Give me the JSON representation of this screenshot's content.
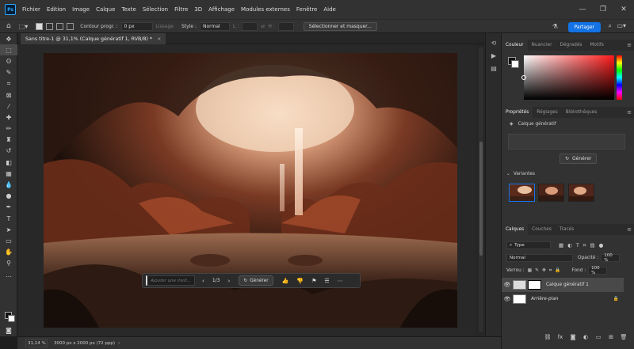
{
  "app": {
    "logo": "Ps"
  },
  "menu": [
    "Fichier",
    "Edition",
    "Image",
    "Calque",
    "Texte",
    "Sélection",
    "Filtre",
    "3D",
    "Affichage",
    "Modules externes",
    "Fenêtre",
    "Aide"
  ],
  "window_controls": {
    "minimize": "—",
    "restore": "❐",
    "close": "✕"
  },
  "options_bar": {
    "feather_label": "Contour progr. :",
    "feather_value": "0 px",
    "antialias_label": "Lissage",
    "style_label": "Style :",
    "style_value": "Normal",
    "width_label": "L :",
    "height_label": "H :",
    "select_mask_label": "Sélectionner et masquer...",
    "share_label": "Partager"
  },
  "document": {
    "tab_title": "Sans titre-1 @ 31,1% (Calque génératif 1, RVB/8) *",
    "close": "×"
  },
  "contextual_bar": {
    "placeholder": "Ajouter une invit...",
    "variation_counter": "1/3",
    "prev": "‹",
    "next": "›",
    "generate_label": "Générer"
  },
  "status_bar": {
    "zoom": "31,14 %",
    "doc_size": "3000 px x 2000 px (72 ppp)"
  },
  "panels": {
    "color_tabs": [
      "Couleur",
      "Nuancier",
      "Dégradés",
      "Motifs"
    ],
    "properties_tabs": [
      "Propriétés",
      "Réglages",
      "Bibliothèques"
    ],
    "properties_layer_type": "Calque génératif",
    "properties_generate_label": "Générer",
    "variants_label": "Variantes",
    "layers_tabs": [
      "Calques",
      "Couches",
      "Tracés"
    ],
    "layer_filter": "Type",
    "blend_mode": "Normal",
    "opacity_label": "Opacité :",
    "opacity_value": "100 %",
    "lock_label": "Verrou :",
    "fill_label": "Fond :",
    "fill_value": "100 %",
    "layers": [
      {
        "name": "Calque génératif 1",
        "selected": true
      },
      {
        "name": "Arrière-plan",
        "selected": false,
        "italic": true
      }
    ]
  },
  "colors": {
    "accent": "#1473e6",
    "ui_bg": "#323232",
    "canvas_bg": "#282828"
  }
}
